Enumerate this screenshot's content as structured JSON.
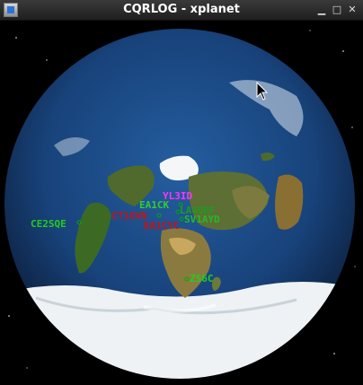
{
  "window": {
    "title": "CQRLOG - xplanet",
    "controls": {
      "minimize": "▁",
      "maximize": "□",
      "close": "✕"
    }
  },
  "map": {
    "stations": [
      {
        "call": "YL3ID",
        "color": "#ff00ff"
      },
      {
        "call": "EA1CK",
        "color": "#00cc00"
      },
      {
        "call": "LA4QBF",
        "color": "#00aa00"
      },
      {
        "call": "CT1GVN",
        "color": "#cc0000"
      },
      {
        "call": "SV1AYD",
        "color": "#00bb00"
      },
      {
        "call": "EA1CYC",
        "color": "#cc0000"
      },
      {
        "call": "CE2SQE",
        "color": "#00cc00"
      },
      {
        "call": "ZS6C",
        "color": "#00cc00"
      }
    ]
  }
}
